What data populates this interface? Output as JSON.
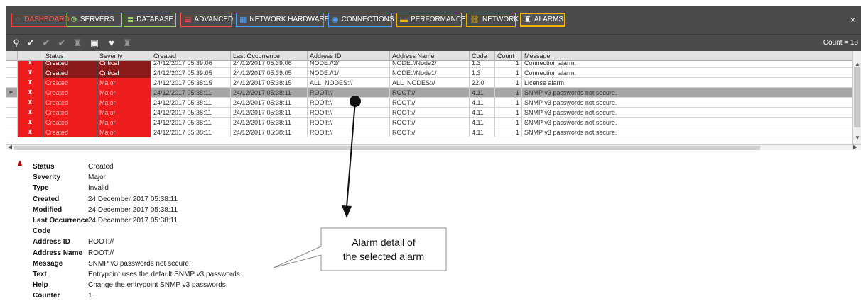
{
  "tabs": [
    {
      "label": "DASHBOARD",
      "icon": "dashboard-icon",
      "color": "#ff3b3b",
      "active": false
    },
    {
      "label": "SERVERS",
      "icon": "gear-icon",
      "color": "#9fd46a",
      "active": false
    },
    {
      "label": "DATABASE",
      "icon": "database-icon",
      "color": "#9fd46a",
      "active": false
    },
    {
      "label": "ADVANCED",
      "icon": "document-icon",
      "color": "#ff4a4a",
      "active": false
    },
    {
      "label": "NETWORK HARDWARE",
      "icon": "network-hardware-icon",
      "color": "#4a9fff",
      "active": false
    },
    {
      "label": "CONNECTIONS",
      "icon": "connections-icon",
      "color": "#4a9fff",
      "active": false
    },
    {
      "label": "PERFORMANCE",
      "icon": "performance-icon",
      "color": "#f2b400",
      "active": false
    },
    {
      "label": "NETWORK",
      "icon": "network-icon",
      "color": "#f2b400",
      "active": false
    },
    {
      "label": "ALARMS",
      "icon": "alarm-icon",
      "color": "#f2b400",
      "active": true
    }
  ],
  "toolbar": {
    "buttons": [
      "search-icon",
      "check-icon",
      "check-dim-icon",
      "double-check-icon",
      "alarm-small-icon",
      "clear-alarm-icon",
      "heart-icon",
      "alarm-off-icon"
    ],
    "count_label": "Count = 18"
  },
  "grid": {
    "columns": [
      "",
      "",
      "Status",
      "Severity",
      "Created",
      "Last Occurrence",
      "Address ID",
      "Address Name",
      "Code",
      "Count",
      "Message"
    ],
    "rows": [
      {
        "status": "Created",
        "severity": "Critical",
        "created": "24/12/2017 05:39:06",
        "last": "24/12/2017 05:39:06",
        "address_id": "NODE://2/",
        "address_name": "NODE://Node2/",
        "code": "1.3",
        "count": "1",
        "message": "Connection alarm."
      },
      {
        "status": "Created",
        "severity": "Critical",
        "created": "24/12/2017 05:39:05",
        "last": "24/12/2017 05:39:05",
        "address_id": "NODE://1/",
        "address_name": "NODE://Node1/",
        "code": "1.3",
        "count": "1",
        "message": "Connection alarm."
      },
      {
        "status": "Created",
        "severity": "Major",
        "created": "24/12/2017 05:38:15",
        "last": "24/12/2017 05:38:15",
        "address_id": "ALL_NODES://",
        "address_name": "ALL_NODES://",
        "code": "22.0",
        "count": "1",
        "message": "License alarm."
      },
      {
        "status": "Created",
        "severity": "Major",
        "created": "24/12/2017 05:38:11",
        "last": "24/12/2017 05:38:11",
        "address_id": "ROOT://",
        "address_name": "ROOT://",
        "code": "4.11",
        "count": "1",
        "message": "SNMP v3 passwords not secure."
      },
      {
        "status": "Created",
        "severity": "Major",
        "created": "24/12/2017 05:38:11",
        "last": "24/12/2017 05:38:11",
        "address_id": "ROOT://",
        "address_name": "ROOT://",
        "code": "4.11",
        "count": "1",
        "message": "SNMP v3 passwords not secure."
      },
      {
        "status": "Created",
        "severity": "Major",
        "created": "24/12/2017 05:38:11",
        "last": "24/12/2017 05:38:11",
        "address_id": "ROOT://",
        "address_name": "ROOT://",
        "code": "4.11",
        "count": "1",
        "message": "SNMP v3 passwords not secure."
      },
      {
        "status": "Created",
        "severity": "Major",
        "created": "24/12/2017 05:38:11",
        "last": "24/12/2017 05:38:11",
        "address_id": "ROOT://",
        "address_name": "ROOT://",
        "code": "4.11",
        "count": "1",
        "message": "SNMP v3 passwords not secure."
      },
      {
        "status": "Created",
        "severity": "Major",
        "created": "24/12/2017 05:38:11",
        "last": "24/12/2017 05:38:11",
        "address_id": "ROOT://",
        "address_name": "ROOT://",
        "code": "4.11",
        "count": "1",
        "message": "SNMP v3 passwords not secure."
      }
    ],
    "selected_row": 3
  },
  "detail": {
    "fields": [
      {
        "label": "Status",
        "value": "Created"
      },
      {
        "label": "Severity",
        "value": "Major"
      },
      {
        "label": "Type",
        "value": "Invalid"
      },
      {
        "label": "Created",
        "value": "24 December 2017 05:38:11"
      },
      {
        "label": "Modified",
        "value": "24 December 2017 05:38:11"
      },
      {
        "label": "Last Occurrence",
        "value": "24 December 2017 05:38:11"
      },
      {
        "label": "Code",
        "value": ""
      },
      {
        "label": "Address ID",
        "value": "ROOT://"
      },
      {
        "label": "Address Name",
        "value": "ROOT://"
      },
      {
        "label": "Message",
        "value": "SNMP v3 passwords not secure."
      },
      {
        "label": "Text",
        "value": "Entrypoint uses the default SNMP v3 passwords."
      },
      {
        "label": "Help",
        "value": "Change the entrypoint SNMP v3 passwords."
      },
      {
        "label": "Counter",
        "value": "1"
      }
    ]
  },
  "callout": {
    "line1": "Alarm detail of",
    "line2": "the selected alarm"
  },
  "colors": {
    "critical": "#8b1a1a",
    "major": "#ee1c1c",
    "active_tab_border": "#f2b400",
    "toolbar_bg": "#4b4b4b"
  }
}
